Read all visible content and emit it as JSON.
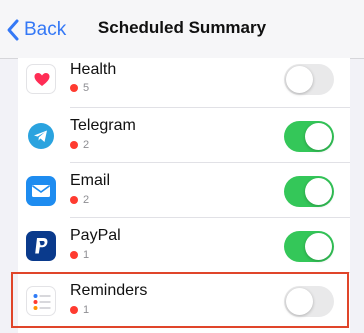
{
  "navbar": {
    "back_label": "Back",
    "title": "Scheduled Summary"
  },
  "apps": [
    {
      "name": "Health",
      "count": "5",
      "icon": "health-heart-icon",
      "enabled": false
    },
    {
      "name": "Telegram",
      "count": "2",
      "icon": "telegram-icon",
      "enabled": true
    },
    {
      "name": "Email",
      "count": "2",
      "icon": "mail-icon",
      "enabled": true
    },
    {
      "name": "PayPal",
      "count": "1",
      "icon": "paypal-icon",
      "enabled": true
    },
    {
      "name": "Reminders",
      "count": "1",
      "icon": "reminders-icon",
      "enabled": false
    }
  ],
  "colors": {
    "accent": "#3478f6",
    "toggle_on": "#34c759",
    "toggle_off": "#e9e9ea",
    "badge_dot": "#ff3b30",
    "highlight": "#e0452a"
  }
}
